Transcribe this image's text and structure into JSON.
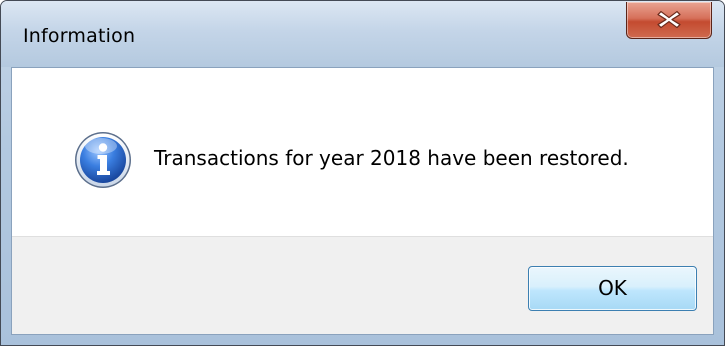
{
  "window": {
    "title": "Information"
  },
  "dialog": {
    "message": "Transactions for year 2018 have been restored.",
    "icon": "info-icon"
  },
  "buttons": {
    "ok_label": "OK",
    "close_icon": "close-icon"
  },
  "colors": {
    "close_button": "#c44b30",
    "ok_button_border": "#3c7fb1",
    "info_icon": "#1f5fbf"
  }
}
